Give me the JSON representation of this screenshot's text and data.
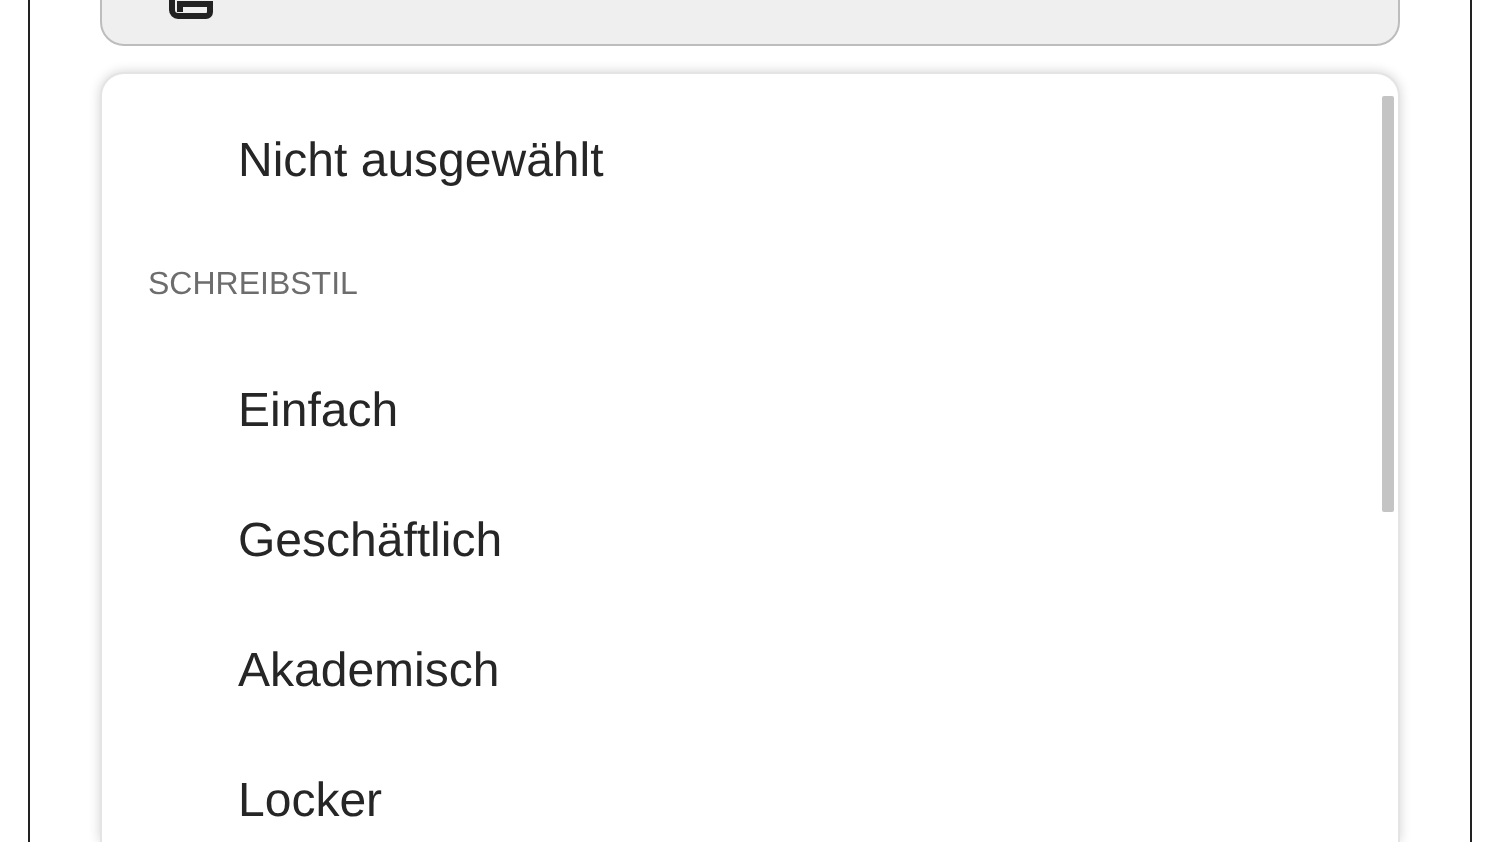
{
  "menu": {
    "items": [
      {
        "kind": "option",
        "label": "Nicht ausgewählt",
        "selected": false
      },
      {
        "kind": "heading",
        "label": "SCHREIBSTIL"
      },
      {
        "kind": "option",
        "label": "Einfach",
        "selected": false
      },
      {
        "kind": "option",
        "label": "Geschäftlich",
        "selected": false
      },
      {
        "kind": "option",
        "label": "Akademisch",
        "selected": false
      },
      {
        "kind": "option",
        "label": "Locker",
        "selected": false
      }
    ]
  }
}
